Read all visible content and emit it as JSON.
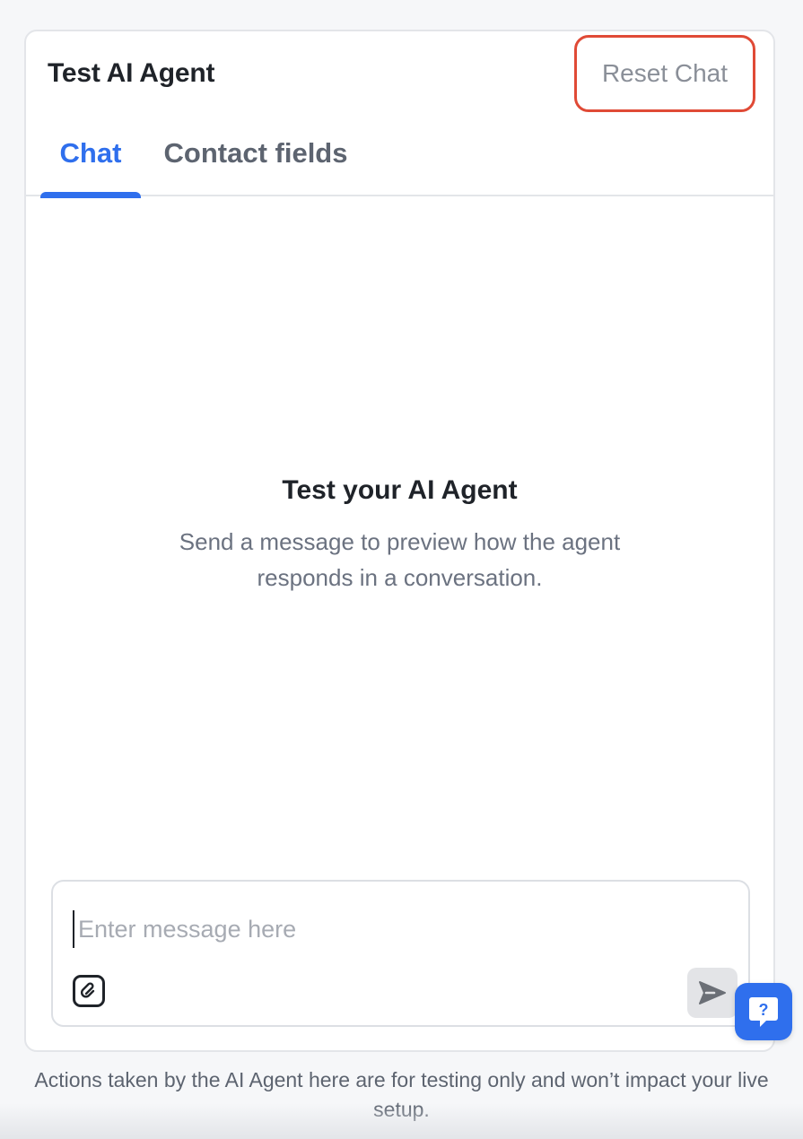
{
  "panel": {
    "title": "Test AI Agent",
    "reset_label": "Reset Chat"
  },
  "tabs": [
    {
      "label": "Chat",
      "active": true
    },
    {
      "label": "Contact fields",
      "active": false
    }
  ],
  "empty_state": {
    "title": "Test your AI Agent",
    "description": "Send a message to preview how the agent responds in a conversation."
  },
  "composer": {
    "placeholder": "Enter message here",
    "value": "",
    "attach_icon": "attachment-icon",
    "send_icon": "send-icon"
  },
  "help": {
    "icon": "help-chat-icon",
    "glyph": "?"
  },
  "footer": {
    "note": "Actions taken by the AI Agent here are for testing only and won’t impact your live setup."
  },
  "colors": {
    "accent": "#2f6fed",
    "reset_border": "#e04a36",
    "muted_text": "#6b7280"
  }
}
